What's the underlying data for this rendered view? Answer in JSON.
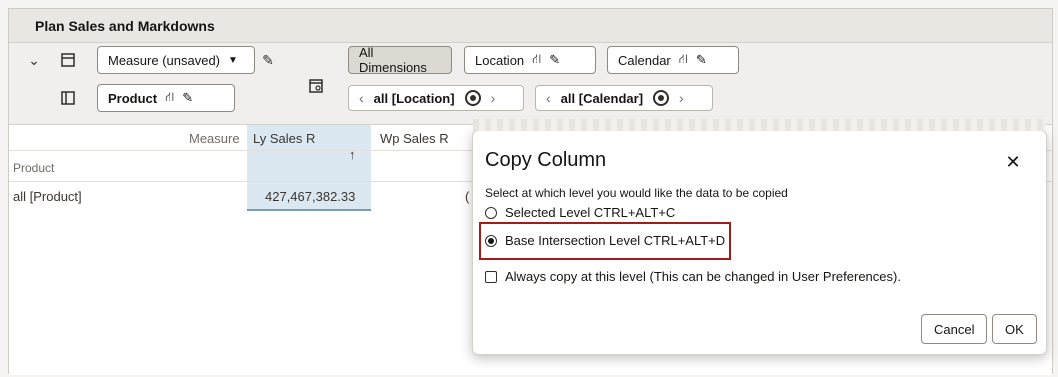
{
  "title": "Plan Sales and Markdowns",
  "toolbar": {
    "measure_label": "Measure (unsaved)",
    "product_label": "Product",
    "all_dimensions_label": "All Dimensions",
    "location_label": "Location",
    "calendar_label": "Calendar",
    "location_nav": "all [Location]",
    "calendar_nav": "all [Calendar]"
  },
  "grid": {
    "measure_header": "Measure",
    "columns": [
      "Ly Sales R",
      "Wp Sales R"
    ],
    "row_header": "Product",
    "row_label": "all [Product]",
    "row_value": "427,467,382.33",
    "sort_indicator": "↑",
    "partial_value": "("
  },
  "dialog": {
    "title": "Copy Column",
    "close": "✕",
    "instruction": "Select at which level you would like the data to be copied",
    "option_selected": "Selected Level  CTRL+ALT+C",
    "option_base": "Base Intersection Level  CTRL+ALT+D",
    "always_copy": "Always copy at this level (This can be changed in User Preferences).",
    "cancel_label": "Cancel",
    "ok_label": "OK",
    "selected_option": "base"
  },
  "colors": {
    "highlight_border": "#a11c1c",
    "selected_column": "#dbe8f1"
  }
}
